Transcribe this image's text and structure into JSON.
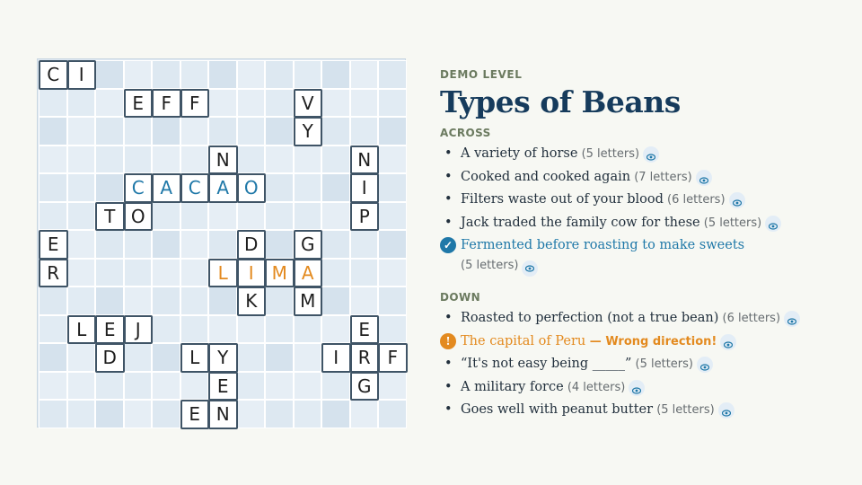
{
  "level_label": "DEMO LEVEL",
  "title": "Types of Beans",
  "across_label": "ACROSS",
  "down_label": "DOWN",
  "across": [
    {
      "text": "A variety of horse",
      "length": "(5 letters)",
      "state": "normal"
    },
    {
      "text": "Cooked and cooked again",
      "length": "(7 letters)",
      "state": "normal"
    },
    {
      "text": "Filters waste out of your blood",
      "length": "(6 letters)",
      "state": "normal"
    },
    {
      "text": "Jack traded the family cow for these",
      "length": "(5 letters)",
      "state": "normal"
    },
    {
      "text": "Fermented before roasting to make sweets",
      "length": "(5 letters)",
      "state": "solved"
    }
  ],
  "down": [
    {
      "text": "Roasted to perfection (not a true bean)",
      "length": "(6 letters)",
      "state": "normal"
    },
    {
      "text": "The capital of Peru",
      "note": " — Wrong direction!",
      "length": "",
      "state": "error"
    },
    {
      "text": "“It's not easy being _____”",
      "length": "(5 letters)",
      "state": "normal"
    },
    {
      "text": "A military force",
      "length": "(4 letters)",
      "state": "normal"
    },
    {
      "text": "Goes well with peanut butter",
      "length": "(5 letters)",
      "state": "normal"
    }
  ],
  "grid": {
    "size": 13,
    "tiles": [
      {
        "r": 0,
        "c": 0,
        "ch": "C"
      },
      {
        "r": 0,
        "c": 1,
        "ch": "I"
      },
      {
        "r": 1,
        "c": 3,
        "ch": "E"
      },
      {
        "r": 1,
        "c": 4,
        "ch": "F"
      },
      {
        "r": 1,
        "c": 5,
        "ch": "F"
      },
      {
        "r": 1,
        "c": 9,
        "ch": "V"
      },
      {
        "r": 2,
        "c": 9,
        "ch": "Y"
      },
      {
        "r": 3,
        "c": 6,
        "ch": "N"
      },
      {
        "r": 3,
        "c": 11,
        "ch": "N"
      },
      {
        "r": 4,
        "c": 3,
        "ch": "C",
        "color": "blue"
      },
      {
        "r": 4,
        "c": 4,
        "ch": "A",
        "color": "blue"
      },
      {
        "r": 4,
        "c": 5,
        "ch": "C",
        "color": "blue"
      },
      {
        "r": 4,
        "c": 6,
        "ch": "A",
        "color": "blue"
      },
      {
        "r": 4,
        "c": 7,
        "ch": "O",
        "color": "blue"
      },
      {
        "r": 4,
        "c": 11,
        "ch": "I"
      },
      {
        "r": 5,
        "c": 2,
        "ch": "T"
      },
      {
        "r": 5,
        "c": 3,
        "ch": "O"
      },
      {
        "r": 5,
        "c": 11,
        "ch": "P"
      },
      {
        "r": 6,
        "c": 0,
        "ch": "E"
      },
      {
        "r": 6,
        "c": 7,
        "ch": "D"
      },
      {
        "r": 6,
        "c": 9,
        "ch": "G"
      },
      {
        "r": 7,
        "c": 0,
        "ch": "R"
      },
      {
        "r": 7,
        "c": 6,
        "ch": "L",
        "color": "orange"
      },
      {
        "r": 7,
        "c": 7,
        "ch": "I",
        "color": "orange"
      },
      {
        "r": 7,
        "c": 8,
        "ch": "M",
        "color": "orange"
      },
      {
        "r": 7,
        "c": 9,
        "ch": "A",
        "color": "orange"
      },
      {
        "r": 8,
        "c": 7,
        "ch": "K"
      },
      {
        "r": 8,
        "c": 9,
        "ch": "M"
      },
      {
        "r": 9,
        "c": 1,
        "ch": "L"
      },
      {
        "r": 9,
        "c": 2,
        "ch": "E"
      },
      {
        "r": 9,
        "c": 3,
        "ch": "J"
      },
      {
        "r": 9,
        "c": 11,
        "ch": "E"
      },
      {
        "r": 10,
        "c": 2,
        "ch": "D"
      },
      {
        "r": 10,
        "c": 5,
        "ch": "L"
      },
      {
        "r": 10,
        "c": 6,
        "ch": "Y"
      },
      {
        "r": 10,
        "c": 10,
        "ch": "I"
      },
      {
        "r": 10,
        "c": 11,
        "ch": "R"
      },
      {
        "r": 10,
        "c": 12,
        "ch": "F"
      },
      {
        "r": 11,
        "c": 6,
        "ch": "E"
      },
      {
        "r": 11,
        "c": 11,
        "ch": "G"
      },
      {
        "r": 12,
        "c": 5,
        "ch": "E"
      },
      {
        "r": 12,
        "c": 6,
        "ch": "N"
      }
    ]
  },
  "colors": {
    "solved": "#1f78a8",
    "error": "#e38a1f",
    "title": "#163b5c"
  },
  "icons": {
    "reveal": "eye-icon",
    "solved": "check-circle-icon",
    "error": "exclamation-circle-icon"
  }
}
